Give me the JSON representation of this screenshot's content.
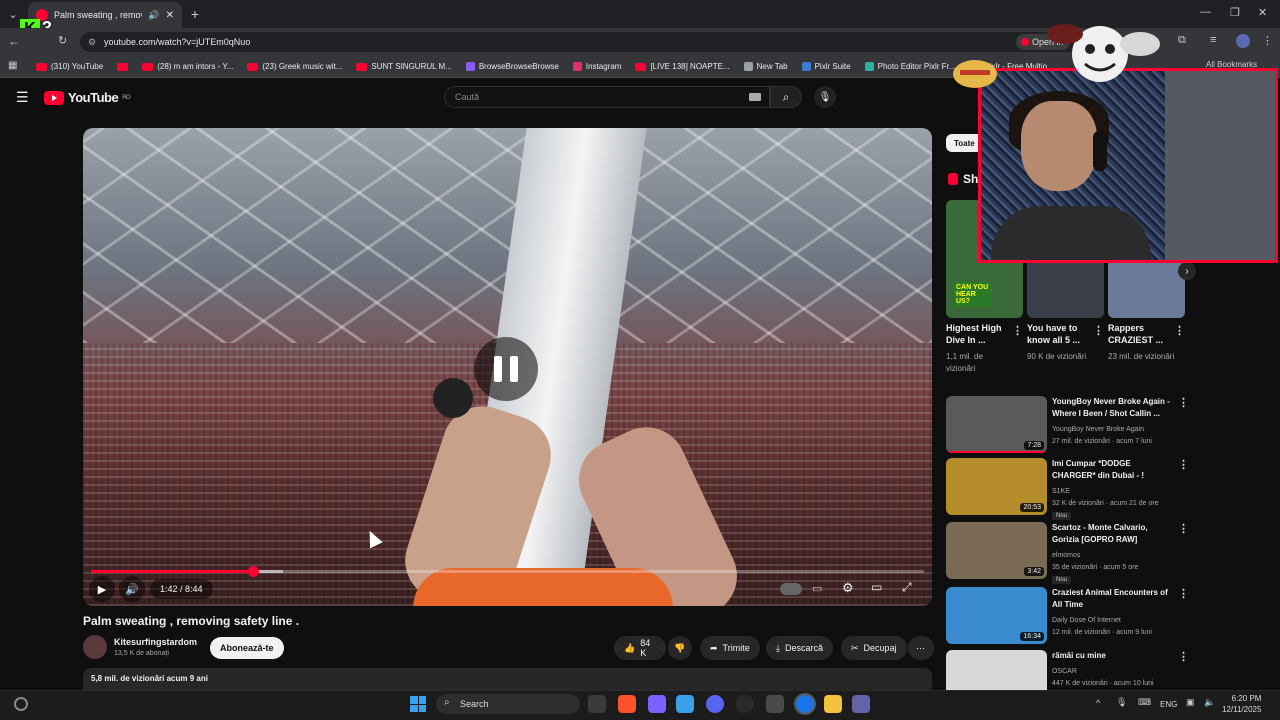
{
  "browser": {
    "tab_title": "Palm sweating , removing s",
    "url": "youtube.com/watch?v=jUTEm0qNuo",
    "open_in": "Open in",
    "kick_badge_number": "3",
    "bookmarks": [
      {
        "label": "(310) YouTube",
        "icon": "youtube-icon"
      },
      {
        "label": "",
        "icon": "youtube-icon"
      },
      {
        "label": "(28) m am intors - Y...",
        "icon": "youtube-icon"
      },
      {
        "label": "(23) Greek music wit...",
        "icon": "youtube-icon"
      },
      {
        "label": "SUNT SINGURUL M...",
        "icon": "youtube-icon"
      },
      {
        "label": "BrowseBrowseBrowse",
        "icon": "browse-icon"
      },
      {
        "label": "Instagram",
        "icon": "instagram-icon"
      },
      {
        "label": "[LIVE 138] NOAPTE...",
        "icon": "youtube-icon"
      },
      {
        "label": "New Tab",
        "icon": "globe-icon"
      },
      {
        "label": "Pixlr Suite",
        "icon": "pixlr-icon"
      },
      {
        "label": "Photo Editor Pixlr Fr...",
        "icon": "photo-editor-icon"
      }
    ],
    "all_bookmarks": "All Bookmarks",
    "extra_bookmark": "Pixlr - Free Multio..."
  },
  "youtube": {
    "logo_text": "YouTube",
    "logo_region": "RO",
    "search_placeholder": "Caută"
  },
  "player": {
    "current_time": "1:42",
    "duration": "8:44",
    "time_display": "1:42 / 8:44",
    "progress_fraction": 0.195,
    "buffer_fraction": 0.23
  },
  "video": {
    "title": "Palm sweating , removing safety line .",
    "channel": "Kitesurfingstardom",
    "subscribers": "13,5 K de abonați",
    "subscribe_label": "Abonează-te",
    "likes": "84 K",
    "share_label": "Trimite",
    "download_label": "Descarcă",
    "clip_label": "Decupaj",
    "views_date": "5,8 mil. de vizionări  acum 9 ani"
  },
  "sidebar": {
    "chip_all": "Toate",
    "shorts_heading": "Sh",
    "shorts": [
      {
        "title": "Highest High Dive In ...",
        "views": "1,1 mil. de vizionări",
        "thumb_text": "CAN YOU HEAR US?"
      },
      {
        "title": "You have to know all 5 ...",
        "views": "90 K de vizionări",
        "thumb_text": ""
      },
      {
        "title": "Rappers CRAZIEST ...",
        "views": "23 mil. de vizionări",
        "thumb_text": ""
      }
    ],
    "recommendations": [
      {
        "title": "YoungBoy Never Broke Again - Where I Been / Shot Callin ...",
        "channel": "YoungBoy Never Broke Again",
        "meta": "27 mil. de vizionări · acum 7 luni",
        "duration": "7:28",
        "new": "",
        "color": "#5a5a5a"
      },
      {
        "title": "Imi Cumpar *DODGE CHARGER* din Dubai - !",
        "channel": "S1KE",
        "meta": "32 K de vizionări · acum 21 de ore",
        "duration": "20:53",
        "new": "Nou",
        "color": "#b58c2a"
      },
      {
        "title": "Scartoz - Monte Calvario, Gorizia [GOPRO RAW]",
        "channel": "elmomos",
        "meta": "35 de vizionări · acum 5 ore",
        "duration": "3:42",
        "new": "Nou",
        "color": "#7a6a55"
      },
      {
        "title": "Craziest Animal Encounters of All Time",
        "channel": "Daily Dose Of Internet",
        "meta": "12 mil. de vizionări · acum 9 luni",
        "duration": "16:34",
        "new": "",
        "color": "#3a8ad0"
      },
      {
        "title": "rămâi cu mine",
        "channel": "OSCAR",
        "meta": "447 K de vizionări · acum 10 luni",
        "duration": "",
        "new": "",
        "color": "#d8d8d8"
      }
    ]
  },
  "taskbar": {
    "search": "Search",
    "lang": "ENG",
    "time": "6:20 PM",
    "date": "12/11/2025"
  },
  "colors": {
    "accent": "#ff0033",
    "bg": "#0f0f0f",
    "kick": "#53fc18"
  }
}
